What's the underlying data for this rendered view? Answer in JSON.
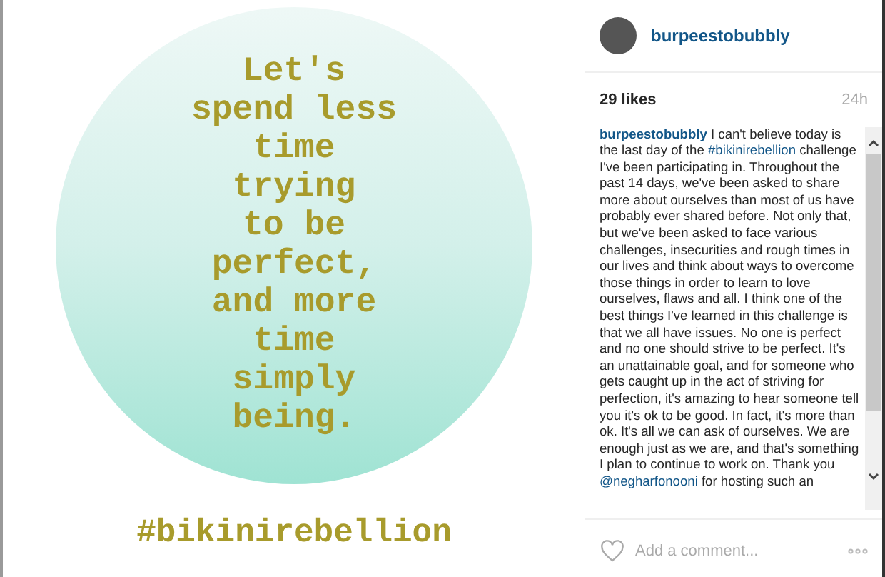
{
  "post_image": {
    "quote_lines": [
      "Let's",
      "spend less",
      "time",
      "trying",
      "to be",
      "perfect,",
      "and more",
      "time",
      "simply",
      "being."
    ],
    "hashtag": "#bikinirebellion"
  },
  "header": {
    "username": "burpeestobubbly"
  },
  "stats": {
    "likes": "29 likes",
    "time": "24h"
  },
  "caption": [
    {
      "kind": "user",
      "text": "burpeestobubbly"
    },
    {
      "kind": "text",
      "text": " I can't believe today is the last day of the "
    },
    {
      "kind": "tag",
      "text": "#bikinirebellion"
    },
    {
      "kind": "text",
      "text": " challenge I've been participating in. Throughout the past 14 days, we've been asked to share more about ourselves than most of us have probably ever shared before. Not only that, but we've been asked to face various challenges, insecurities and rough times in our lives and think about ways to overcome those things in order to learn to love ourselves, flaws and all. I think one of the best things I've learned in this challenge is that we all have issues. No one is perfect and no one should strive to be perfect. It's an unattainable goal, and for someone who gets caught up in the act of striving for perfection, it's amazing to hear someone tell you it's ok to be good. In fact, it's more than ok. It's all we can ask of ourselves. We are enough just as we are, and that's something I plan to continue to work on. Thank you "
    },
    {
      "kind": "mention",
      "text": "@negharfonooni"
    },
    {
      "kind": "text",
      "text": " for hosting such an"
    }
  ],
  "comment": {
    "placeholder": "Add a comment...",
    "liked": false
  }
}
